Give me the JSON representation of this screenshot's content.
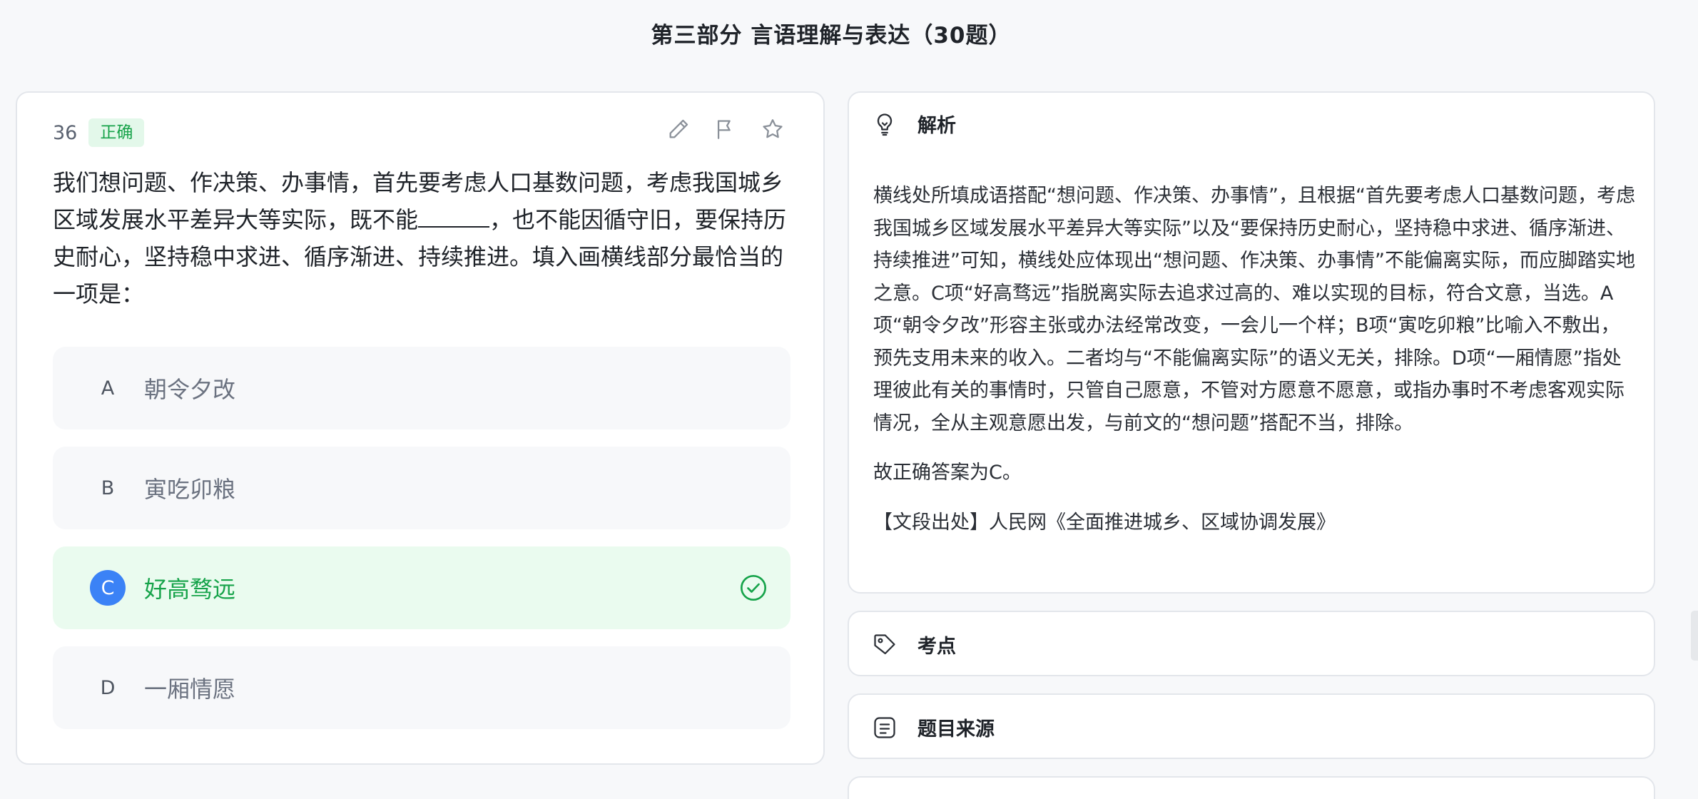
{
  "page": {
    "title": "第三部分 言语理解与表达（30题）"
  },
  "question": {
    "number": "36",
    "status_badge": "正确",
    "stem_part1": "我们想问题、作决策、办事情，首先要考虑人口基数问题，考虑我国城乡区域发展水平差异大等实际，既不能",
    "stem_part2": "，也不能因循守旧，要保持历史耐心，坚持稳中求进、循序渐进、持续推进。填入画横线部分最恰当的一项是：",
    "options": [
      {
        "letter": "A",
        "text": "朝令夕改",
        "state": "normal"
      },
      {
        "letter": "B",
        "text": "寅吃卯粮",
        "state": "normal"
      },
      {
        "letter": "C",
        "text": "好高骛远",
        "state": "correct"
      },
      {
        "letter": "D",
        "text": "一厢情愿",
        "state": "normal"
      }
    ],
    "tools": [
      "pencil-icon",
      "flag-icon",
      "star-icon"
    ]
  },
  "analysis": {
    "title": "解析",
    "icon": "lightbulb-icon",
    "paragraph1": "横线处所填成语搭配“想问题、作决策、办事情”，且根据“首先要考虑人口基数问题，考虑我国城乡区域发展水平差异大等实际”以及“要保持历史耐心，坚持稳中求进、循序渐进、持续推进”可知，横线处应体现出“想问题、作决策、办事情”不能偏离实际，而应脚踏实地之意。C项“好高骛远”指脱离实际去追求过高的、难以实现的目标，符合文意，当选。A项“朝令夕改”形容主张或办法经常改变，一会儿一个样；B项“寅吃卯粮”比喻入不敷出，预先支用未来的收入。二者均与“不能偏离实际”的语义无关，排除。D项“一厢情愿”指处理彼此有关的事情时，只管自己愿意，不管对方愿意不愿意，或指办事时不考虑客观实际情况，全从主观意愿出发，与前文的“想问题”搭配不当，排除。",
    "paragraph2": "故正确答案为C。",
    "paragraph3": "【文段出处】人民网《全面推进城乡、区域协调发展》"
  },
  "knowledge": {
    "title": "考点",
    "icon": "tag-icon"
  },
  "source": {
    "title": "题目来源",
    "icon": "list-icon"
  },
  "colors": {
    "correct_green": "#16a34a",
    "accent_blue": "#3b82f6",
    "badge_bg": "#e3f8ea"
  }
}
